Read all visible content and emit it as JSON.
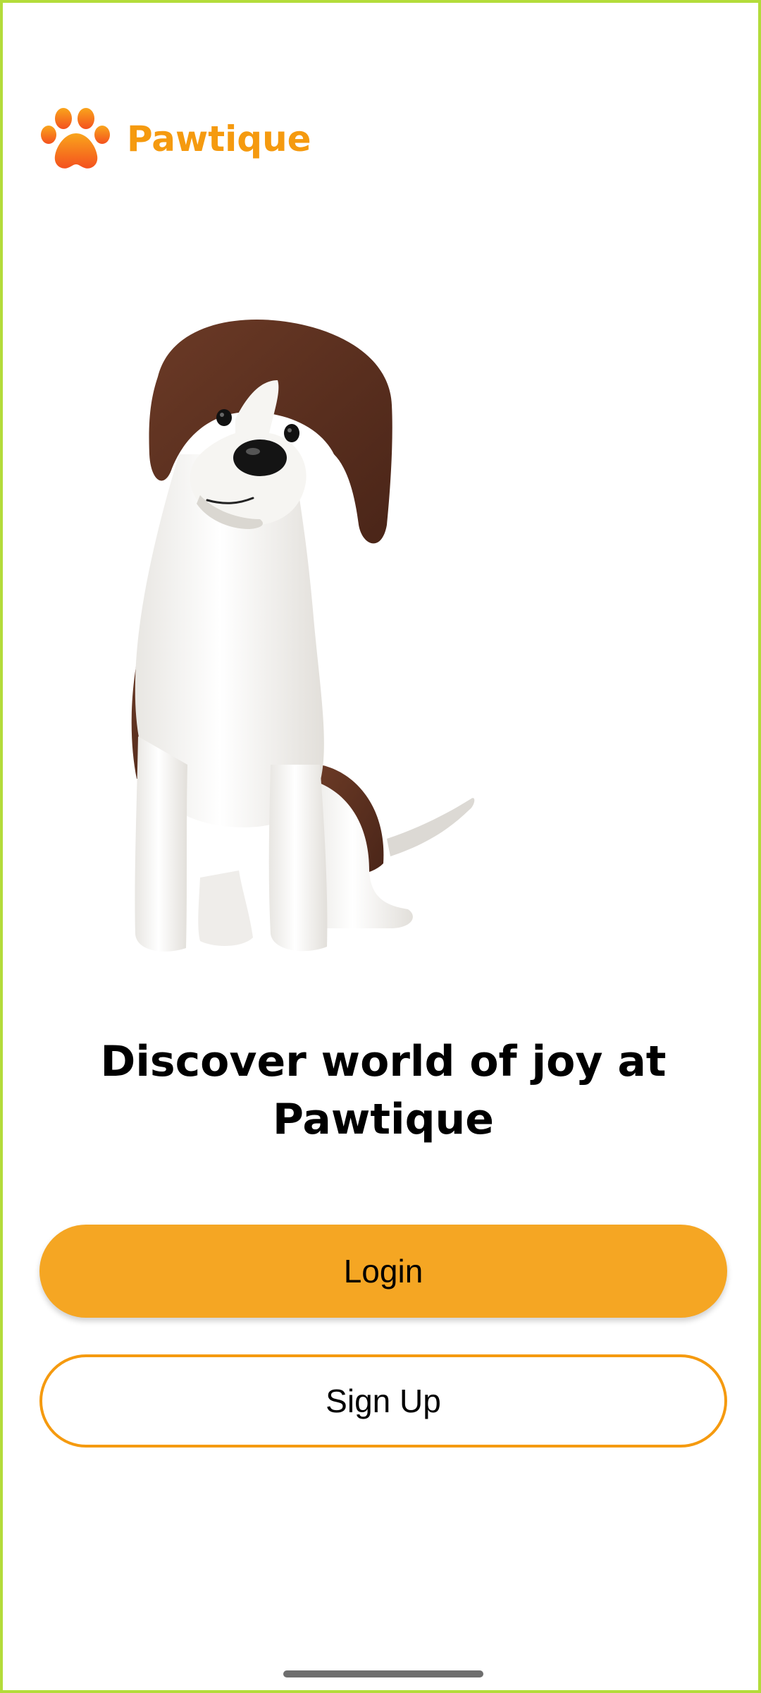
{
  "app": {
    "brand_name": "Pawtique",
    "brand_icon": "paw-icon",
    "brand_color": "#f59a0f"
  },
  "hero": {
    "illustration": "dog-illustration",
    "headline": "Discover world of joy at Pawtique"
  },
  "actions": {
    "login_label": "Login",
    "signup_label": "Sign Up",
    "primary_color": "#f5a623"
  },
  "colors": {
    "frame_border": "#b3dc3a",
    "background": "#ffffff",
    "dog_brown": "#5a3020"
  }
}
